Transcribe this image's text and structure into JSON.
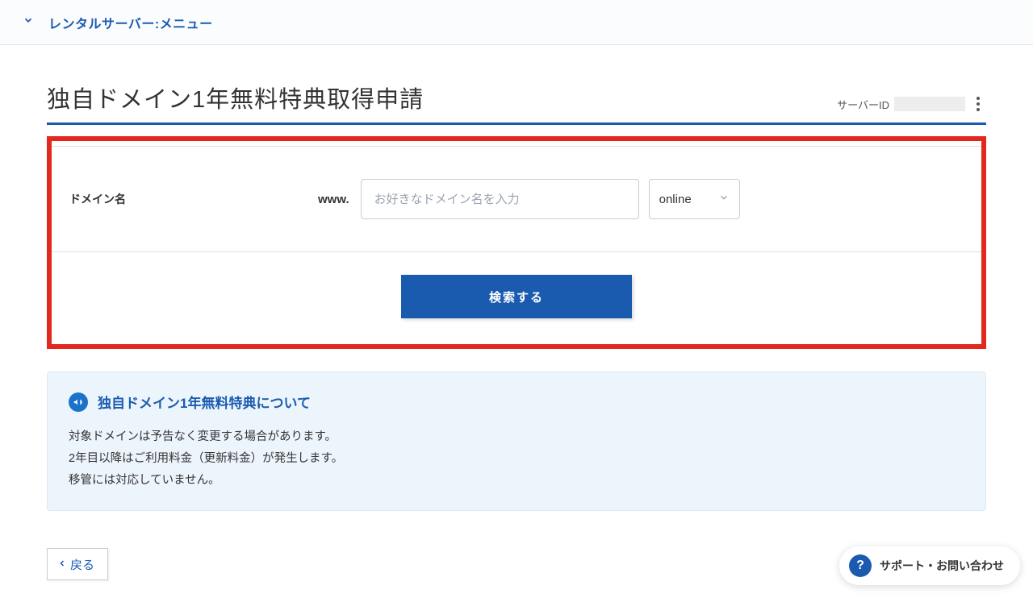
{
  "topbar": {
    "menu_label": "レンタルサーバー:メニュー"
  },
  "header": {
    "title": "独自ドメイン1年無料特典取得申請",
    "server_id_label": "サーバーID",
    "server_id_value": ""
  },
  "form": {
    "domain_label": "ドメイン名",
    "www_prefix": "www.",
    "domain_placeholder": "お好きなドメイン名を入力",
    "tld_selected": "online",
    "search_button": "検索する"
  },
  "info": {
    "title": "独自ドメイン1年無料特典について",
    "line1": "対象ドメインは予告なく変更する場合があります。",
    "line2": "2年目以降はご利用料金（更新料金）が発生します。",
    "line3": "移管には対応していません。"
  },
  "footer": {
    "back_label": "戻る"
  },
  "support": {
    "label": "サポート・お問い合わせ"
  }
}
